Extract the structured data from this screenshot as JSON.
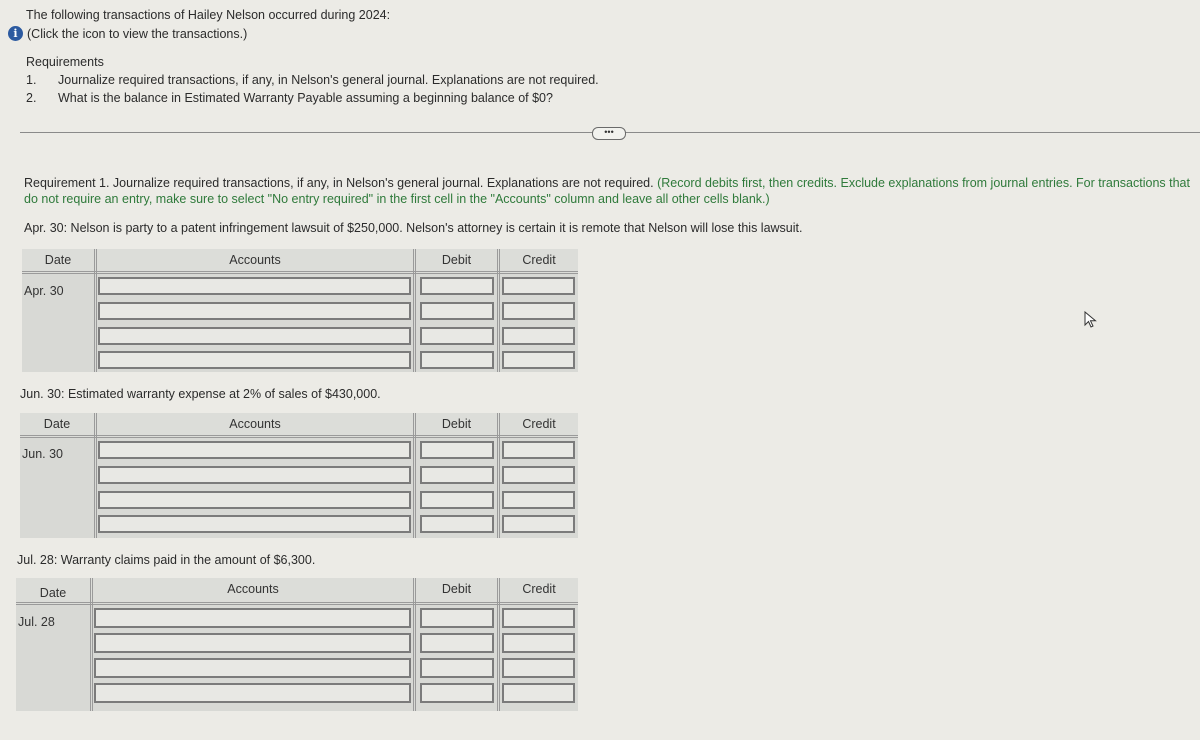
{
  "intro": {
    "text": "The following transactions of Hailey Nelson occurred during 2024:",
    "icon": "info-icon",
    "link_text": "(Click the icon to view the transactions.)"
  },
  "requirements": {
    "title": "Requirements",
    "items": [
      {
        "num": "1.",
        "text": "Journalize required transactions, if any, in Nelson's general journal. Explanations are not required."
      },
      {
        "num": "2.",
        "text": "What is the balance in Estimated Warranty Payable assuming a beginning balance of $0?"
      }
    ]
  },
  "more_button": "•••",
  "requirement1": {
    "lead": "Requirement 1. Journalize required transactions, if any, in Nelson's general journal. Explanations are not required.",
    "instruction": "(Record debits first, then credits. Exclude explanations from journal entries. For transactions that do not require an entry, make sure to select \"No entry required\" in the first cell in the \"Accounts\" column and leave all other cells blank.)"
  },
  "columns": {
    "date": "Date",
    "accounts": "Accounts",
    "debit": "Debit",
    "credit": "Credit"
  },
  "transactions": [
    {
      "description": "Apr. 30: Nelson is party to a patent infringement lawsuit of $250,000. Nelson's attorney is certain it is remote that Nelson will lose this lawsuit.",
      "date": "Apr. 30",
      "rows": [
        {
          "account": "",
          "debit": "",
          "credit": ""
        },
        {
          "account": "",
          "debit": "",
          "credit": ""
        },
        {
          "account": "",
          "debit": "",
          "credit": ""
        },
        {
          "account": "",
          "debit": "",
          "credit": ""
        }
      ]
    },
    {
      "description": "Jun. 30: Estimated warranty expense at 2% of sales of $430,000.",
      "date": "Jun. 30",
      "rows": [
        {
          "account": "",
          "debit": "",
          "credit": ""
        },
        {
          "account": "",
          "debit": "",
          "credit": ""
        },
        {
          "account": "",
          "debit": "",
          "credit": ""
        },
        {
          "account": "",
          "debit": "",
          "credit": ""
        }
      ]
    },
    {
      "description": "Jul. 28: Warranty claims paid in the amount of $6,300.",
      "date": "Jul. 28",
      "rows": [
        {
          "account": "",
          "debit": "",
          "credit": ""
        },
        {
          "account": "",
          "debit": "",
          "credit": ""
        },
        {
          "account": "",
          "debit": "",
          "credit": ""
        },
        {
          "account": "",
          "debit": "",
          "credit": ""
        }
      ]
    }
  ]
}
